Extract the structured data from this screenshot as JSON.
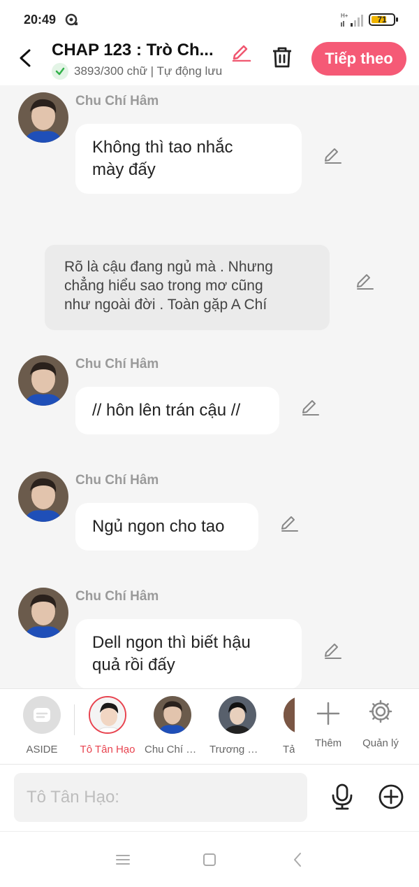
{
  "status": {
    "time": "20:49",
    "battery": "71",
    "network": "H+",
    "battery_level": 0.71
  },
  "header": {
    "title": "CHAP 123 : Trò Ch...",
    "word_count": "3893/300 chữ | Tự động lưu",
    "next_label": "Tiếp theo"
  },
  "messages": [
    {
      "type": "character",
      "name": "Chu Chí Hâm",
      "text_lines": [
        "Không thì tao nhắc",
        "mày đấy"
      ]
    },
    {
      "type": "aside",
      "text_lines": [
        "Rõ là cậu đang ngủ mà . Nhưng",
        "chẳng hiểu sao trong mơ cũng",
        "như ngoài đời . Toàn gặp A Chí"
      ]
    },
    {
      "type": "character",
      "name": "Chu Chí Hâm",
      "text_lines": [
        "// hôn lên trán cậu //"
      ]
    },
    {
      "type": "character",
      "name": "Chu Chí Hâm",
      "text_lines": [
        "Ngủ ngon cho tao"
      ]
    },
    {
      "type": "character",
      "name": "Chu Chí Hâm",
      "text_lines": [
        "Dell ngon thì biết hậu",
        "quả rồi đấy"
      ]
    }
  ],
  "characters": [
    {
      "label": "ASIDE"
    },
    {
      "label": "Tô Tân Hạo"
    },
    {
      "label": "Chu Chí H..."
    },
    {
      "label": "Trương Cực"
    },
    {
      "label": "Tả"
    }
  ],
  "tools": {
    "add_label": "Thêm",
    "manage_label": "Quản lý"
  },
  "input": {
    "placeholder": "Tô Tân Hạo:"
  },
  "colors": {
    "accent": "#f55a76",
    "active_char": "#e8434f"
  }
}
